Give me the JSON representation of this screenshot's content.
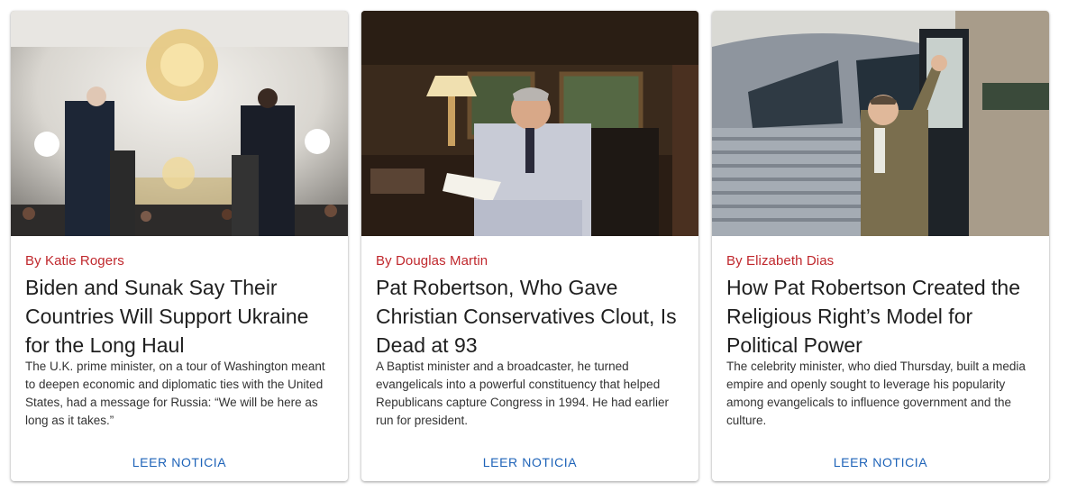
{
  "articles": [
    {
      "byline": "By Katie Rogers",
      "title": "Biden and Sunak Say Their Countries Will Support Ukraine for the Long Haul",
      "summary": "The U.K. prime minister, on a tour of Washington meant to deepen economic and diplomatic ties with the United States, had a message for Russia: “We will be here as long as it takes.”",
      "button": "LEER NOTICIA",
      "image": "press-conference-photo"
    },
    {
      "byline": "By Douglas Martin",
      "title": "Pat Robertson, Who Gave Christian Conservatives Clout, Is Dead at 93",
      "summary": "A Baptist minister and a broadcaster, he turned evangelicals into a powerful constituency that helped Republicans capture Congress in 1994. He had earlier run for president.",
      "button": "LEER NOTICIA",
      "image": "portrait-in-study-photo"
    },
    {
      "byline": "By Elizabeth Dias",
      "title": "How Pat Robertson Created the Religious Right’s Model for Political Power",
      "summary": "The celebrity minister, who died Thursday, built a media empire and openly sought to leverage his popularity among evangelicals to influence government and the culture.",
      "button": "LEER NOTICIA",
      "image": "man-waving-from-bus-photo"
    }
  ],
  "colors": {
    "byline": "#c0282d",
    "button": "#1e63b8",
    "title": "#1f1f1f"
  }
}
